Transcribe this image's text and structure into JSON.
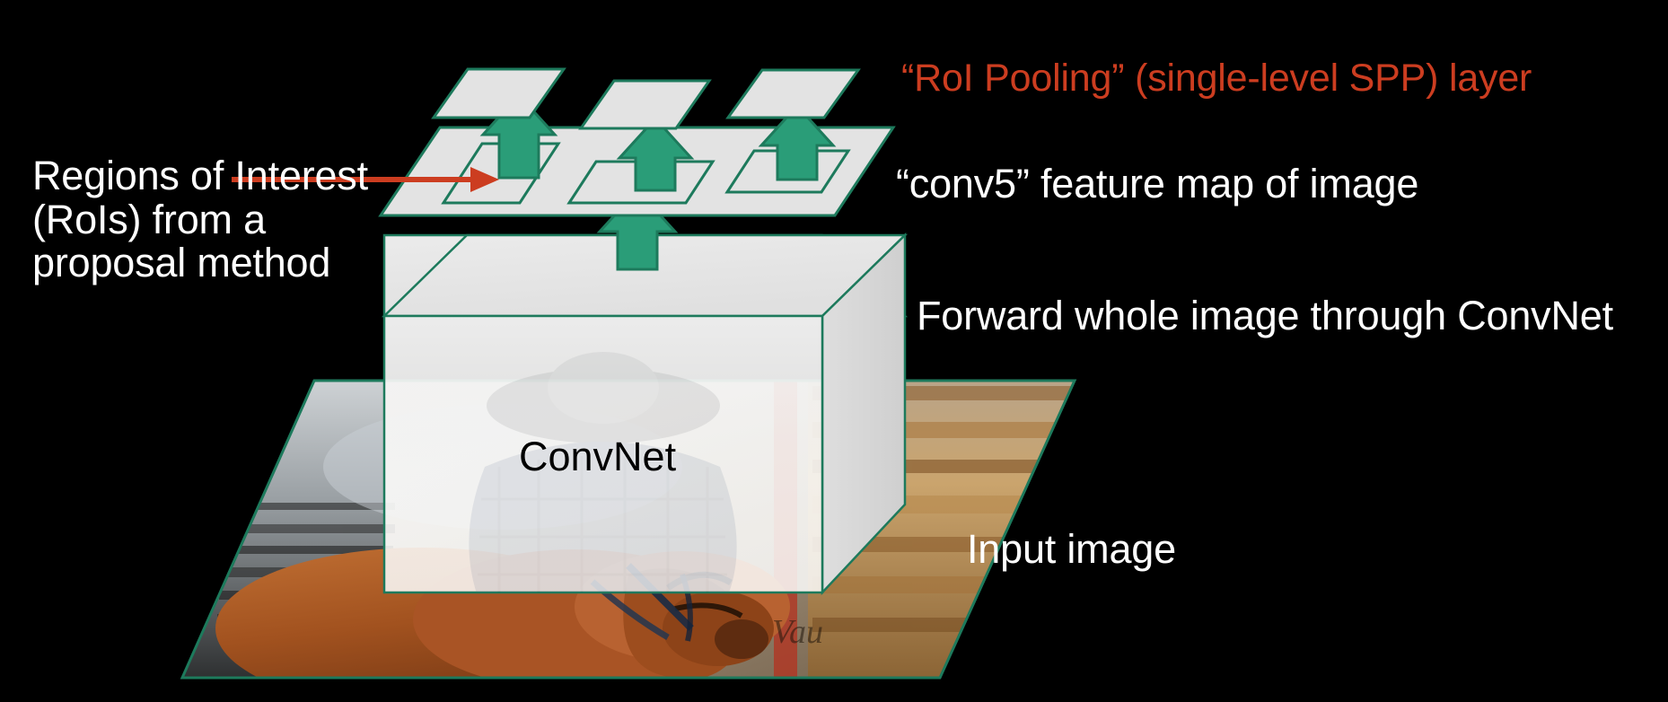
{
  "slide": {
    "background_color": "#000000",
    "accent_green": "#2a9d78",
    "accent_green_dark": "#1d7a5c",
    "accent_orange": "#cc3d20",
    "plane_fill": "#e3e3e3",
    "text_color": "#ffffff"
  },
  "labels": {
    "regions_of_interest": "Regions of Interest (RoIs) from a proposal method",
    "roi_pooling": "“RoI Pooling” (single-level SPP) layer",
    "conv5_feature_map": "“conv5” feature map of image",
    "forward_whole_image": "Forward whole image through ConvNet",
    "input_image": "Input image",
    "convnet": "ConvNet"
  },
  "diagram": {
    "pooled_tiles_count": 3,
    "roi_boxes_count": 3,
    "arrows_up_count": 4,
    "pointer_arrow_color": "#cc3d20",
    "planes": [
      {
        "name": "pooled-output-tiles",
        "fill": "#e3e3e3",
        "stroke": "#1d7a5c"
      },
      {
        "name": "conv5-feature-map-plane",
        "fill": "#e3e3e3",
        "stroke": "#1d7a5c"
      },
      {
        "name": "input-image-plane",
        "fill": "image",
        "stroke": "#1d7a5c"
      }
    ],
    "convnet_box": {
      "label": "ConvNet",
      "fill": "rgba(244,244,244,0.93)",
      "stroke": "#1d7a5c"
    },
    "photo_description": "cowboy on a horse at a rodeo"
  }
}
